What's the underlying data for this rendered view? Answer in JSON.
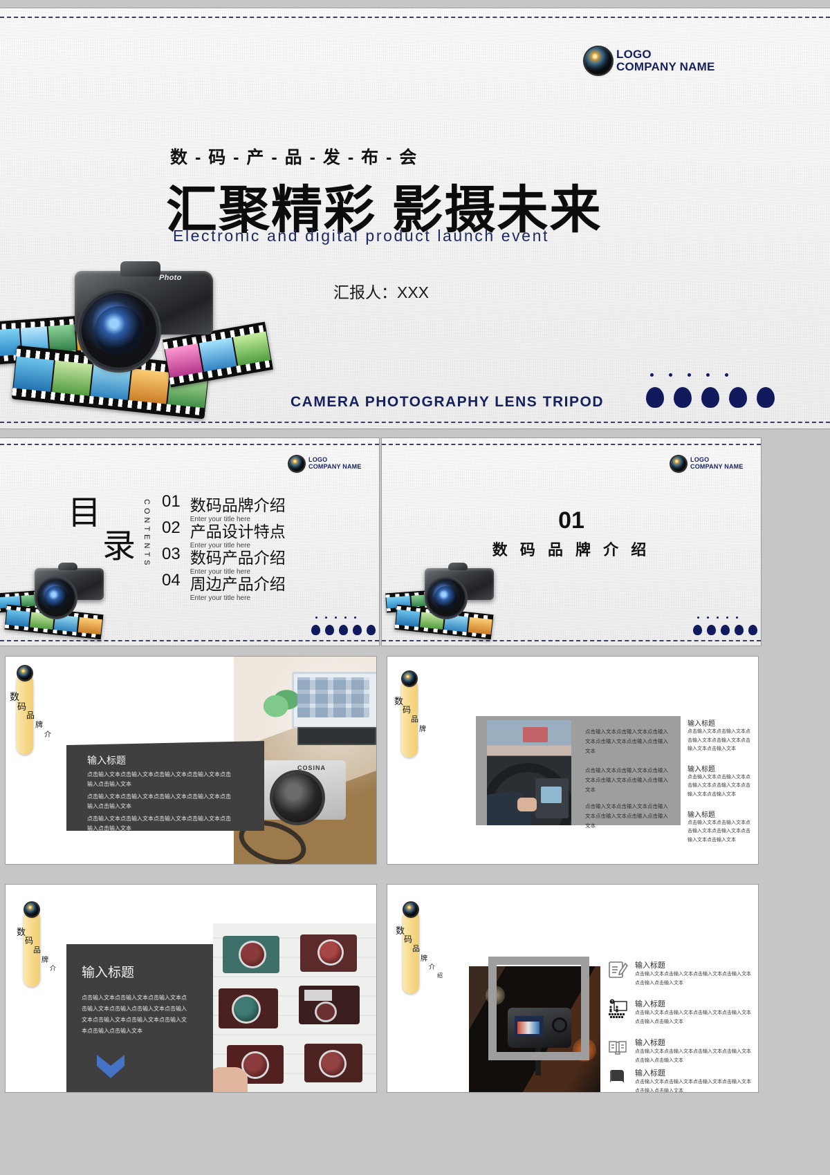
{
  "brand": {
    "logo_icon": "camera-lens-icon",
    "logo_label": "LOGO",
    "company_name": "COMPANY NAME",
    "navy": "#16205c",
    "dot_navy": "#101a5c",
    "yellow_tab": "#f6d88a",
    "dark_card": "#3f3f3f",
    "accent_blue": "#4472c4"
  },
  "slide1": {
    "kicker": "数 - 码 - 产 - 品 - 发 - 布 - 会",
    "title": "汇聚精彩 影摄未来",
    "subtitle": "Electronic and digital product launch event",
    "presenter": "汇报人：XXX",
    "keywords": "CAMERA  PHOTOGRAPHY  LENS TRIPOD"
  },
  "slide2": {
    "mulu_line1": "目",
    "mulu_line2": "录",
    "contents_label": "CONTENTS",
    "items": [
      {
        "num": "01",
        "title": "数码品牌介绍",
        "sub": "Enter your title here"
      },
      {
        "num": "02",
        "title": "产品设计特点",
        "sub": "Enter your title here"
      },
      {
        "num": "03",
        "title": "数码产品介绍",
        "sub": "Enter your title here"
      },
      {
        "num": "04",
        "title": "周边产品介绍",
        "sub": "Enter your title here"
      }
    ]
  },
  "slide3": {
    "number": "01",
    "title": "数 码 品 牌 介 绍"
  },
  "tab": {
    "chars": [
      "数",
      "码",
      "品",
      "牌",
      "介",
      "绍"
    ]
  },
  "slide4": {
    "card_title": "输入标题",
    "card_paragraphs": [
      "点击输入文本点击输入文本点击输入文本点击输入文本点击输入点击输入文本",
      "点击输入文本点击输入文本点击输入文本点击输入文本点击输入点击输入文本",
      "点击输入文本点击输入文本点击输入文本点击输入文本点击输入点击输入文本"
    ],
    "photo_alt": "desk-with-laptop-and-film-camera"
  },
  "slide5": {
    "photo_alt": "driver-hands-on-steering-wheel",
    "gray_paragraphs": [
      "点击输入文本点击输入文本点击输入文本点击输入文本点击输入点击输入文本",
      "点击输入文本点击输入文本点击输入文本点击输入文本点击输入点击输入文本",
      "点击输入文本点击输入文本点击输入文本点击输入文本点击输入点击输入文本"
    ],
    "side_items": [
      {
        "title": "输入标题",
        "body": "点击输入文本点击输入文本点击输入文本点击输入文本点击输入文本点击输入文本"
      },
      {
        "title": "输入标题",
        "body": "点击输入文本点击输入文本点击输入文本点击输入文本点击输入文本点击输入文本"
      },
      {
        "title": "输入标题",
        "body": "点击输入文本点击输入文本点击输入文本点击输入文本点击输入文本点击输入文本"
      }
    ]
  },
  "slide6": {
    "card_title": "输入标题",
    "card_body": "点击输入文本点击输入文本点击输入文本点击输入文本点击输入点击输入文本点击输入文本点击输入文本点击输入文本点击输入文本点击输入点击输入文本",
    "photo_alt": "vintage-cameras-on-white-wall",
    "chevron_icon": "chevron-down-icon"
  },
  "slide7": {
    "photo_alt": "dslr-camera-on-tripod-bokeh",
    "items": [
      {
        "icon": "note-pencil-icon",
        "title": "输入标题",
        "body": "点击输入文本点击输入文本点击输入文本点击输入文本点击输入点击输入文本"
      },
      {
        "icon": "presentation-audience-icon",
        "title": "输入标题",
        "body": "点击输入文本点击输入文本点击输入文本点击输入文本点击输入点击输入文本"
      },
      {
        "icon": "open-book-icon",
        "title": "输入标题",
        "body": "点击输入文本点击输入文本点击输入文本点击输入文本点击输入点击输入文本"
      },
      {
        "icon": "closed-book-icon",
        "title": "输入标题",
        "body": "点击输入文本点击输入文本点击输入文本点击输入文本点击输入点击输入文本"
      }
    ]
  }
}
